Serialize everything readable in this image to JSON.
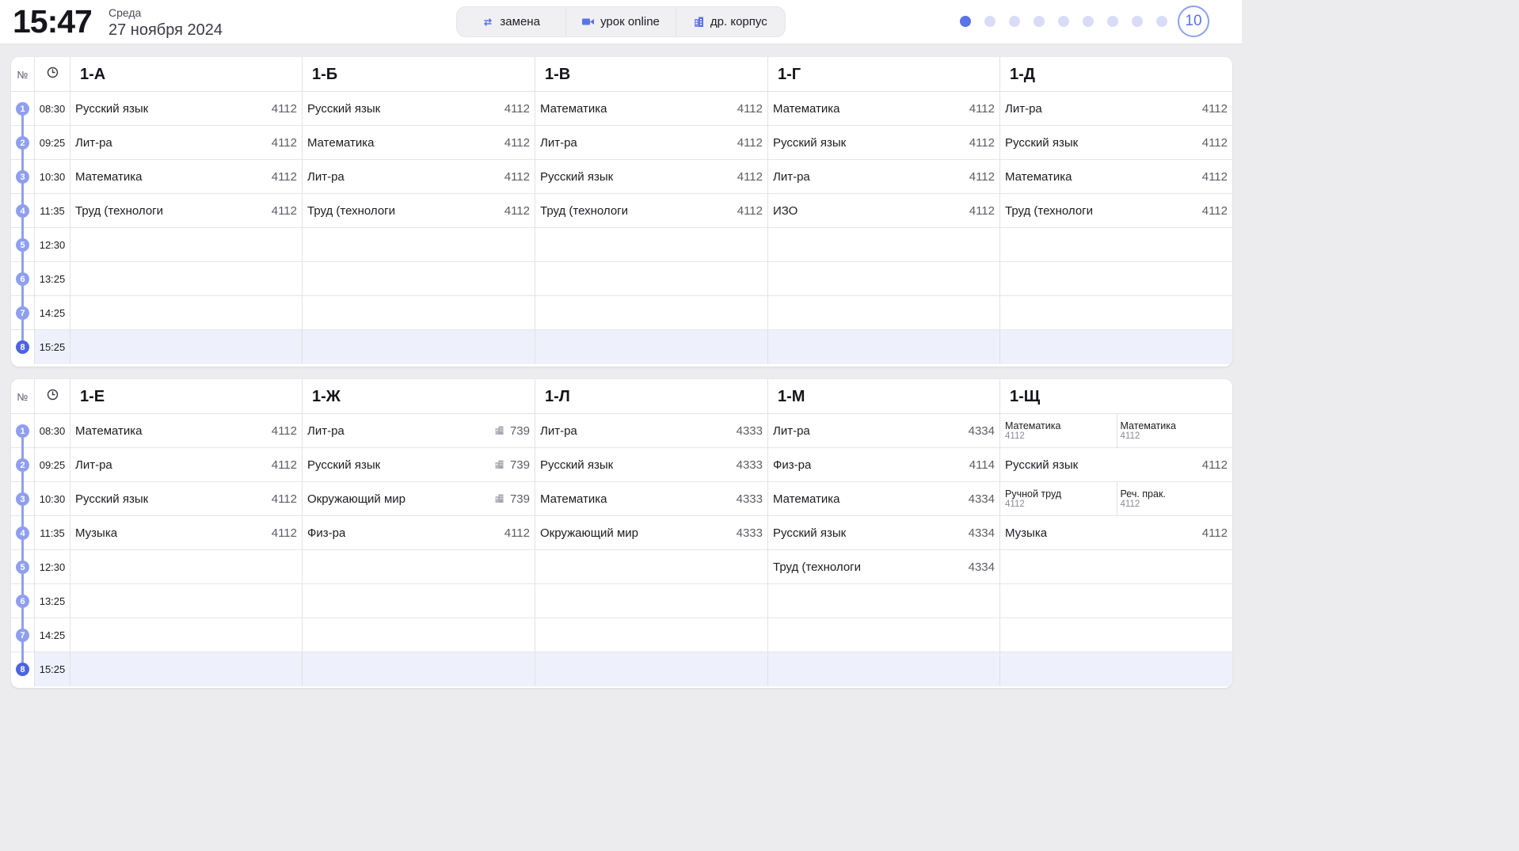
{
  "header": {
    "time": "15:47",
    "weekday": "Среда",
    "date": "27 ноября 2024",
    "legend": [
      {
        "icon": "swap-icon",
        "label": "замена"
      },
      {
        "icon": "video-camera-icon",
        "label": "урок online"
      },
      {
        "icon": "building-icon",
        "label": "др. корпус"
      }
    ],
    "pager": {
      "total_dots": 10,
      "active_index": 0,
      "page_label": "10"
    }
  },
  "colors": {
    "accent": "#5a73e6",
    "badge": "#8f9ff0",
    "current_row": "#eef0fb"
  },
  "grid_header": {
    "num_label": "№",
    "time_icon": "clock-icon"
  },
  "panels": [
    {
      "classes": [
        "1-А",
        "1-Б",
        "1-В",
        "1-Г",
        "1-Д"
      ],
      "rows": [
        {
          "n": "1",
          "time": "08:30",
          "cells": [
            {
              "subj": "Русский язык",
              "room": "4112"
            },
            {
              "subj": "Русский язык",
              "room": "4112"
            },
            {
              "subj": "Математика",
              "room": "4112"
            },
            {
              "subj": "Математика",
              "room": "4112"
            },
            {
              "subj": "Лит-ра",
              "room": "4112"
            }
          ]
        },
        {
          "n": "2",
          "time": "09:25",
          "cells": [
            {
              "subj": "Лит-ра",
              "room": "4112"
            },
            {
              "subj": "Математика",
              "room": "4112"
            },
            {
              "subj": "Лит-ра",
              "room": "4112"
            },
            {
              "subj": "Русский язык",
              "room": "4112"
            },
            {
              "subj": "Русский язык",
              "room": "4112"
            }
          ]
        },
        {
          "n": "3",
          "time": "10:30",
          "cells": [
            {
              "subj": "Математика",
              "room": "4112"
            },
            {
              "subj": "Лит-ра",
              "room": "4112"
            },
            {
              "subj": "Русский язык",
              "room": "4112"
            },
            {
              "subj": "Лит-ра",
              "room": "4112"
            },
            {
              "subj": "Математика",
              "room": "4112"
            }
          ]
        },
        {
          "n": "4",
          "time": "11:35",
          "cells": [
            {
              "subj": "Труд (технологи",
              "room": "4112"
            },
            {
              "subj": "Труд (технологи",
              "room": "4112"
            },
            {
              "subj": "Труд (технологи",
              "room": "4112"
            },
            {
              "subj": "ИЗО",
              "room": "4112"
            },
            {
              "subj": "Труд (технологи",
              "room": "4112"
            }
          ]
        },
        {
          "n": "5",
          "time": "12:30",
          "cells": [
            {},
            {},
            {},
            {},
            {}
          ]
        },
        {
          "n": "6",
          "time": "13:25",
          "cells": [
            {},
            {},
            {},
            {},
            {}
          ]
        },
        {
          "n": "7",
          "time": "14:25",
          "cells": [
            {},
            {},
            {},
            {},
            {}
          ]
        },
        {
          "n": "8",
          "time": "15:25",
          "current": true,
          "cells": [
            {},
            {},
            {},
            {},
            {}
          ]
        }
      ]
    },
    {
      "classes": [
        "1-Е",
        "1-Ж",
        "1-Л",
        "1-М",
        "1-Щ"
      ],
      "rows": [
        {
          "n": "1",
          "time": "08:30",
          "cells": [
            {
              "subj": "Математика",
              "room": "4112"
            },
            {
              "subj": "Лит-ра",
              "room": "739",
              "other_building": true
            },
            {
              "subj": "Лит-ра",
              "room": "4333"
            },
            {
              "subj": "Лит-ра",
              "room": "4334"
            },
            {
              "split": [
                {
                  "subj": "Математика",
                  "room": "4112"
                },
                {
                  "subj": "Математика",
                  "room": "4112"
                }
              ]
            }
          ]
        },
        {
          "n": "2",
          "time": "09:25",
          "cells": [
            {
              "subj": "Лит-ра",
              "room": "4112"
            },
            {
              "subj": "Русский язык",
              "room": "739",
              "other_building": true
            },
            {
              "subj": "Русский язык",
              "room": "4333"
            },
            {
              "subj": "Физ-ра",
              "room": "4114"
            },
            {
              "subj": "Русский язык",
              "room": "4112"
            }
          ]
        },
        {
          "n": "3",
          "time": "10:30",
          "cells": [
            {
              "subj": "Русский язык",
              "room": "4112"
            },
            {
              "subj": "Окружающий мир",
              "room": "739",
              "other_building": true
            },
            {
              "subj": "Математика",
              "room": "4333"
            },
            {
              "subj": "Математика",
              "room": "4334"
            },
            {
              "split": [
                {
                  "subj": "Ручной труд",
                  "room": "4112"
                },
                {
                  "subj": "Реч. прак.",
                  "room": "4112"
                }
              ]
            }
          ]
        },
        {
          "n": "4",
          "time": "11:35",
          "cells": [
            {
              "subj": "Музыка",
              "room": "4112"
            },
            {
              "subj": "Физ-ра",
              "room": "4112"
            },
            {
              "subj": "Окружающий мир",
              "room": "4333"
            },
            {
              "subj": "Русский язык",
              "room": "4334"
            },
            {
              "subj": "Музыка",
              "room": "4112"
            }
          ]
        },
        {
          "n": "5",
          "time": "12:30",
          "cells": [
            {},
            {},
            {},
            {
              "subj": "Труд (технологи",
              "room": "4334"
            },
            {}
          ]
        },
        {
          "n": "6",
          "time": "13:25",
          "cells": [
            {},
            {},
            {},
            {},
            {}
          ]
        },
        {
          "n": "7",
          "time": "14:25",
          "cells": [
            {},
            {},
            {},
            {},
            {}
          ]
        },
        {
          "n": "8",
          "time": "15:25",
          "current": true,
          "cells": [
            {},
            {},
            {},
            {},
            {}
          ]
        }
      ]
    }
  ]
}
